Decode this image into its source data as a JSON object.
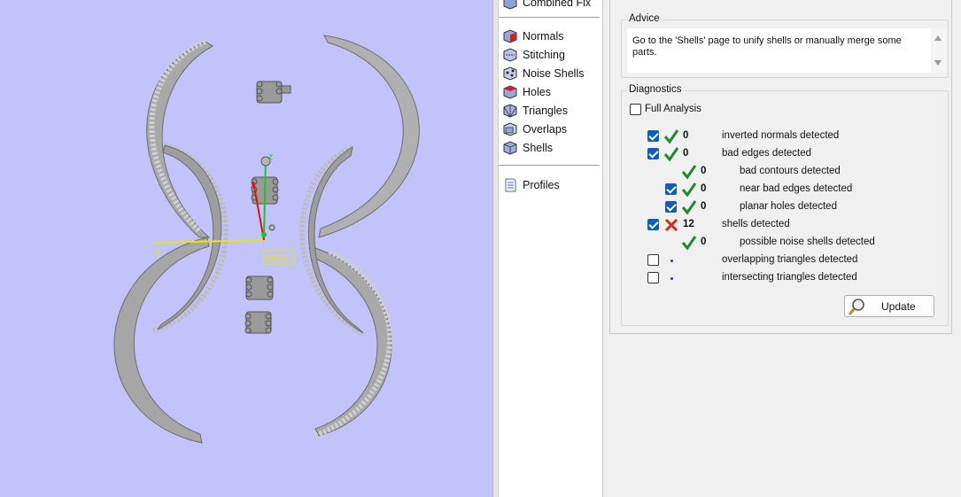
{
  "navigation": {
    "top_partial_label": "Combined Fix",
    "items": [
      {
        "label": "Normals",
        "icon": "normals-cube-icon"
      },
      {
        "label": "Stitching",
        "icon": "stitching-cube-icon"
      },
      {
        "label": "Noise Shells",
        "icon": "noise-shells-cube-icon"
      },
      {
        "label": "Holes",
        "icon": "holes-cube-icon"
      },
      {
        "label": "Triangles",
        "icon": "triangles-cube-icon"
      },
      {
        "label": "Overlaps",
        "icon": "overlaps-cube-icon"
      },
      {
        "label": "Shells",
        "icon": "shells-cube-icon"
      }
    ],
    "profiles_label": "Profiles"
  },
  "advice": {
    "title": "Advice",
    "text": "Go to the 'Shells' page to unify shells or manually merge some parts."
  },
  "diagnostics": {
    "title": "Diagnostics",
    "full_analysis_label": "Full Analysis",
    "full_analysis_checked": false,
    "rows": [
      {
        "checkbox": true,
        "checked": true,
        "status": "ok",
        "count": "0",
        "label": "inverted normals detected",
        "indent": 0
      },
      {
        "checkbox": true,
        "checked": true,
        "status": "ok",
        "count": "0",
        "label": "bad edges detected",
        "indent": 0
      },
      {
        "checkbox": false,
        "checked": false,
        "status": "ok",
        "count": "0",
        "label": "bad contours detected",
        "indent": 1
      },
      {
        "checkbox": true,
        "checked": true,
        "status": "ok",
        "count": "0",
        "label": "near bad edges detected",
        "indent": 1
      },
      {
        "checkbox": true,
        "checked": true,
        "status": "ok",
        "count": "0",
        "label": "planar holes detected",
        "indent": 1
      },
      {
        "checkbox": true,
        "checked": true,
        "status": "error",
        "count": "12",
        "label": "shells detected",
        "indent": 0
      },
      {
        "checkbox": false,
        "checked": false,
        "status": "ok",
        "count": "0",
        "label": "possible noise shells detected",
        "indent": 1
      },
      {
        "checkbox": true,
        "checked": false,
        "status": "none",
        "count": "",
        "label": "overlapping triangles detected",
        "indent": 0
      },
      {
        "checkbox": true,
        "checked": false,
        "status": "none",
        "count": "",
        "label": "intersecting triangles detected",
        "indent": 0
      }
    ],
    "update_label": "Update"
  },
  "viewport": {
    "axis_y_label": "y",
    "axis_z_label": "z",
    "axis_x_label": "x",
    "wcs_label": "WCS"
  },
  "colors": {
    "viewport_bg": "#c3c3fb",
    "part_gray": "#a4a4a4",
    "ok_green": "#1f8a2c",
    "error_red": "#d42a1a",
    "checkbox_blue": "#0a5dc2"
  }
}
